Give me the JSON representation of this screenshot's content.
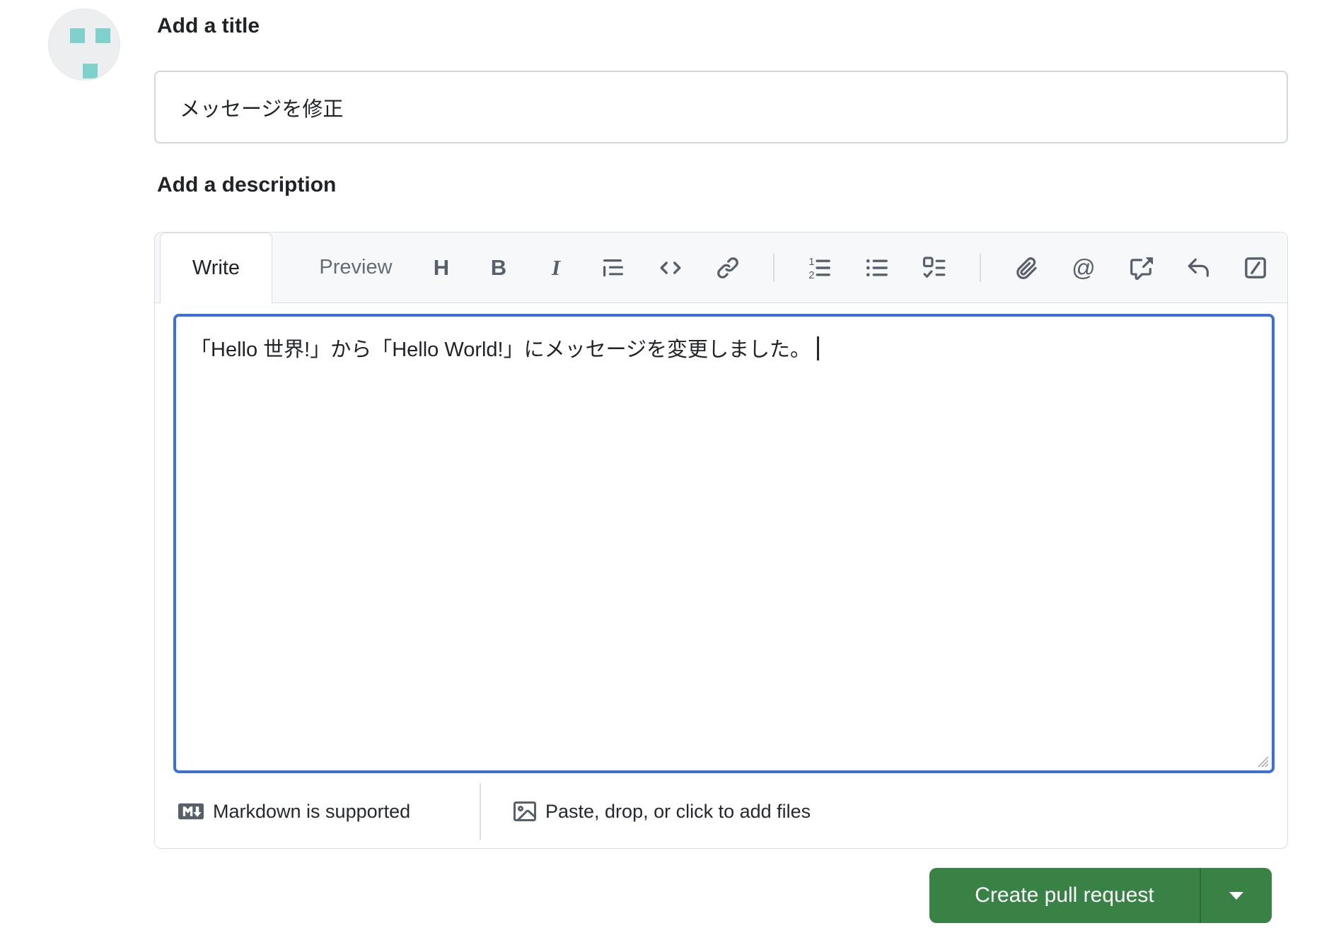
{
  "colors": {
    "focus_border_blue": "#3b6fd9",
    "primary_button_green": "#388245",
    "avatar_square_teal": "#7fd2cb",
    "tabbar_background": "#f6f8fa",
    "border_gray": "#d8dee4",
    "icon_gray": "#57606a",
    "text_dark": "#1f2328",
    "text_muted": "#636c76"
  },
  "avatar": {
    "icon": "identicon-avatar"
  },
  "title_section": {
    "heading": "Add a title",
    "input_value": "メッセージを修正"
  },
  "description_section": {
    "heading": "Add a description",
    "tabs": {
      "write": "Write",
      "preview": "Preview"
    },
    "toolbar": {
      "heading_glyph": "H",
      "bold_glyph": "B",
      "italic_glyph": "I",
      "mention_glyph": "@",
      "ordered_num1": "1",
      "ordered_num2": "2",
      "icons": [
        "heading-icon",
        "bold-icon",
        "italic-icon",
        "quote-icon",
        "code-icon",
        "link-icon",
        "ordered-list-icon",
        "unordered-list-icon",
        "task-list-icon",
        "attach-file-icon",
        "mention-icon",
        "cross-reference-icon",
        "reply-icon",
        "slash-command-icon"
      ]
    },
    "editor_text": "「Hello 世界!」から「Hello World!」にメッセージを変更しました。",
    "footer": {
      "markdown_label": "Markdown is supported",
      "paste_label": "Paste, drop, or click to add files"
    }
  },
  "actions": {
    "create_label": "Create pull request"
  }
}
